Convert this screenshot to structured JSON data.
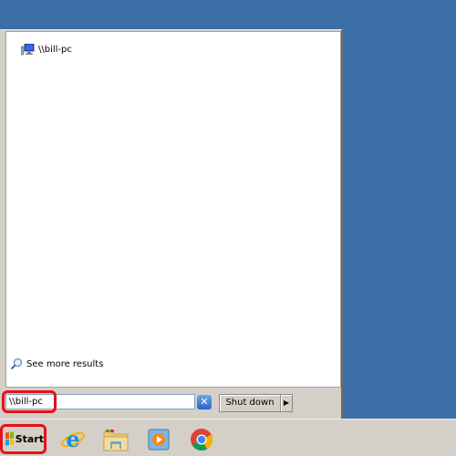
{
  "start_menu": {
    "results": [
      {
        "label": "\\\\bill-pc",
        "icon": "computer-icon"
      }
    ],
    "see_more_label": "See more results",
    "search_value": "\\\\bill-pc",
    "clear_symbol": "✕",
    "shutdown_label": "Shut down",
    "shutdown_arrow": "▶"
  },
  "taskbar": {
    "start_label": "Start",
    "pinned": [
      {
        "name": "internet-explorer",
        "icon": "internet-explorer-icon"
      },
      {
        "name": "windows-explorer",
        "icon": "folder-icon"
      },
      {
        "name": "windows-media-player",
        "icon": "media-player-icon"
      },
      {
        "name": "google-chrome",
        "icon": "chrome-icon"
      }
    ]
  },
  "colors": {
    "desktop": "#3a6ea5",
    "highlight": "#e8101a",
    "taskbar": "#d4d0c8"
  }
}
